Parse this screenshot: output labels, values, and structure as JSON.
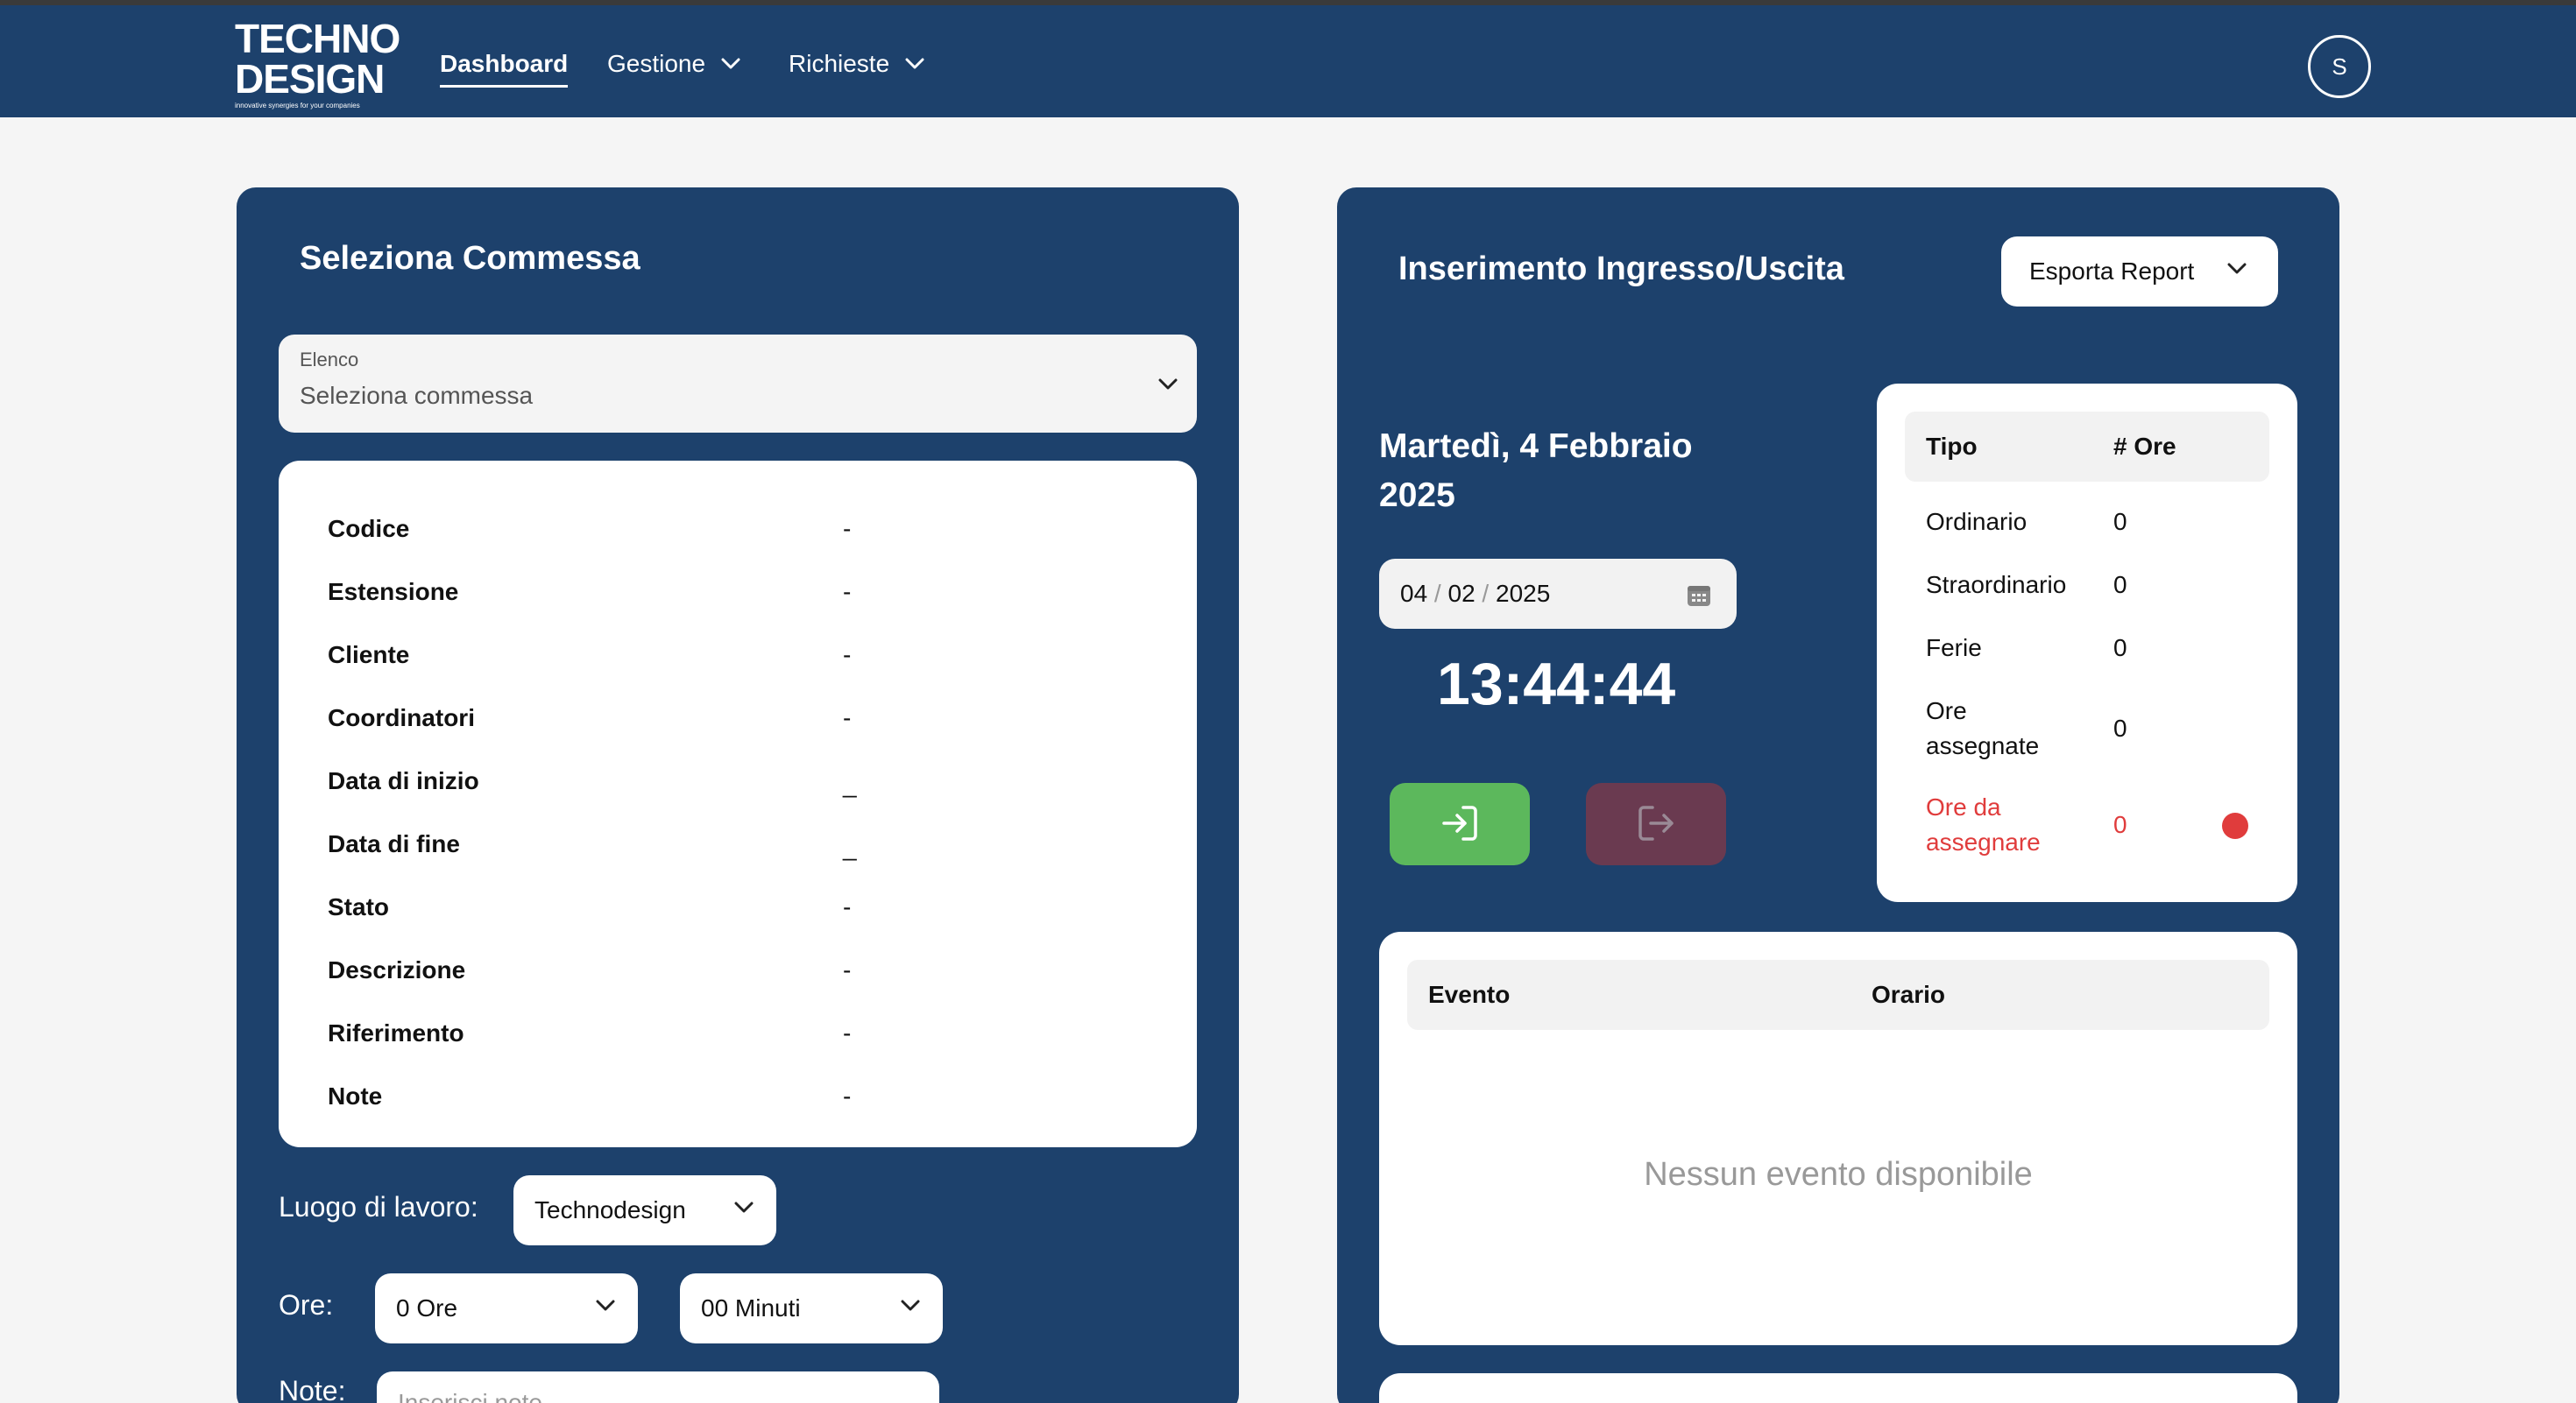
{
  "brand": {
    "line1": "TECHNO",
    "line2": "DESIGN",
    "tagline": "innovative synergies for your companies"
  },
  "nav": {
    "items": [
      {
        "label": "Dashboard",
        "active": true
      },
      {
        "label": "Gestione",
        "dropdown": true
      },
      {
        "label": "Richieste",
        "dropdown": true
      }
    ],
    "avatar_initial": "S"
  },
  "commessa": {
    "title": "Seleziona Commessa",
    "select_caption": "Elenco",
    "select_placeholder": "Seleziona commessa",
    "details": [
      {
        "label": "Codice",
        "value": "-"
      },
      {
        "label": "Estensione",
        "value": "-"
      },
      {
        "label": "Cliente",
        "value": "-"
      },
      {
        "label": "Coordinatori",
        "value": "-"
      },
      {
        "label": "Data di inizio",
        "value": "_"
      },
      {
        "label": "Data di fine",
        "value": "_"
      },
      {
        "label": "Stato",
        "value": "-"
      },
      {
        "label": "Descrizione",
        "value": "-"
      },
      {
        "label": "Riferimento",
        "value": "-"
      },
      {
        "label": "Note",
        "value": "-"
      }
    ],
    "luogo_label": "Luogo di lavoro:",
    "luogo_value": "Technodesign",
    "ore_label": "Ore:",
    "ore_value": "0 Ore",
    "minuti_value": "00 Minuti",
    "note_label": "Note:",
    "note_placeholder": "Inserisci note"
  },
  "timbratura": {
    "title": "Inserimento Ingresso/Uscita",
    "export_label": "Esporta Report",
    "date_heading": "Martedì, 4 Febbraio 2025",
    "date_input": {
      "day": "04",
      "month": "02",
      "year": "2025"
    },
    "clock": "13:44:44",
    "colors": {
      "entrata": "#5cb85c",
      "uscita": "#6a3a50",
      "alert": "#e03c3c"
    },
    "hours_table": {
      "headers": [
        "Tipo",
        "# Ore"
      ],
      "rows": [
        {
          "tipo": "Ordinario",
          "ore": "0"
        },
        {
          "tipo": "Straordinario",
          "ore": "0"
        },
        {
          "tipo": "Ferie",
          "ore": "0"
        },
        {
          "tipo": "Ore assegnate",
          "ore": "0"
        },
        {
          "tipo": "Ore da assegnare",
          "ore": "0",
          "alert": true
        }
      ]
    },
    "events_table": {
      "headers": [
        "Evento",
        "Orario"
      ],
      "empty_message": "Nessun evento disponibile"
    }
  }
}
